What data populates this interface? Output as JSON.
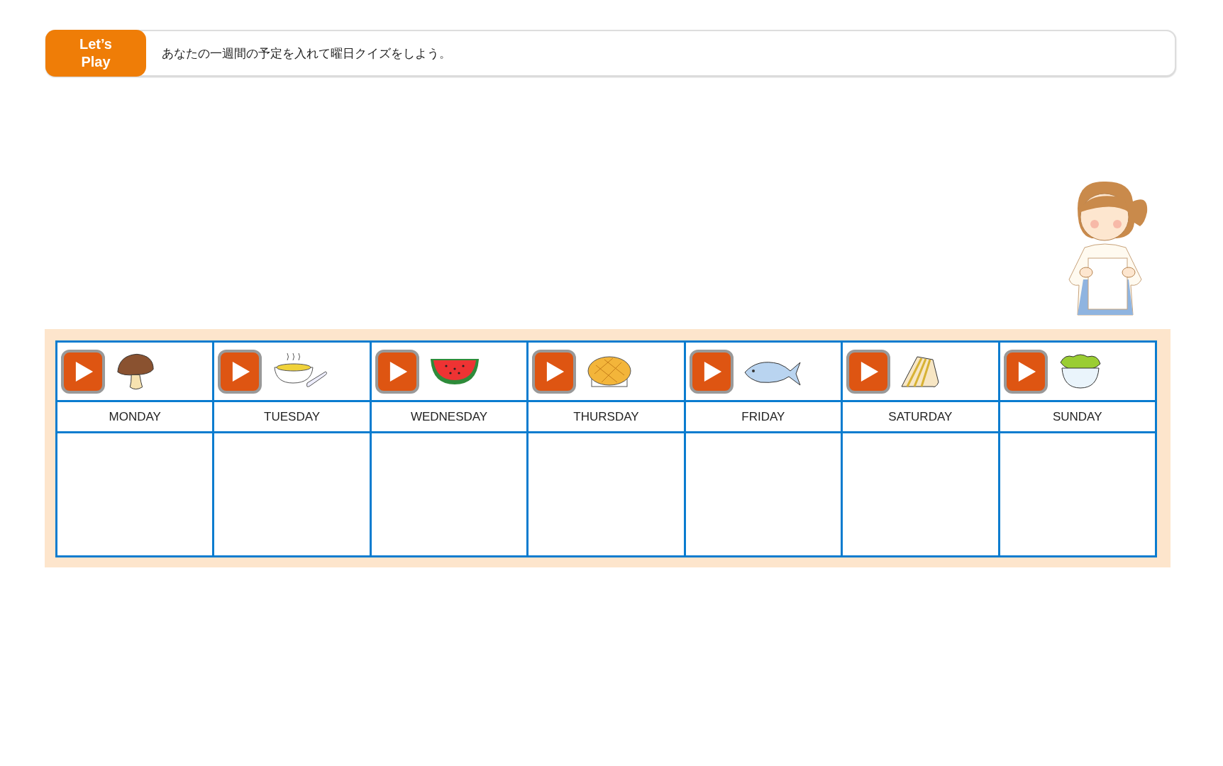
{
  "header": {
    "badge": "Let’s Play",
    "instruction": "あなたの一週間の予定を入れて曜日クイズをしよう。"
  },
  "days": [
    {
      "label": "MONDAY",
      "kind": "mushroom"
    },
    {
      "label": "TUESDAY",
      "kind": "soup"
    },
    {
      "label": "WEDNESDAY",
      "kind": "watermelon"
    },
    {
      "label": "THURSDAY",
      "kind": "bun"
    },
    {
      "label": "FRIDAY",
      "kind": "fish"
    },
    {
      "label": "SATURDAY",
      "kind": "sandwich"
    },
    {
      "label": "SUNDAY",
      "kind": "salad"
    }
  ]
}
